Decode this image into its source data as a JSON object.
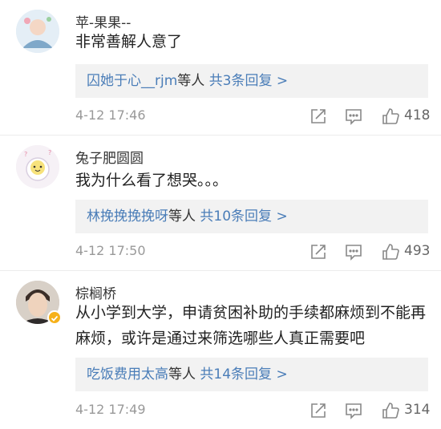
{
  "comments": [
    {
      "username": "苹-果果--",
      "text": "非常善解人意了",
      "reply_names": "囚她于心__rjm",
      "reply_mid": "等人",
      "reply_count": "共3条回复 >",
      "time": "4-12 17:46",
      "likes": "418",
      "verified": false
    },
    {
      "username": "兔子肥圆圆",
      "text": "我为什么看了想哭。。。",
      "reply_names": "林挽挽挽挽呀",
      "reply_mid": "等人",
      "reply_count": "共10条回复 >",
      "time": "4-12 17:50",
      "likes": "493",
      "verified": false
    },
    {
      "username": "棕榈桥",
      "text": "从小学到大学，申请贫困补助的手续都麻烦到不能再麻烦，或许是通过来筛选哪些人真正需要吧",
      "reply_names": "吃饭费用太高",
      "reply_mid": "等人",
      "reply_count": "共14条回复 >",
      "time": "4-12 17:49",
      "likes": "314",
      "verified": true
    }
  ],
  "icons": {
    "share": "share-icon",
    "reply": "comment-icon",
    "like": "thumbs-up-icon"
  },
  "colors": {
    "link_blue": "#4a7db8",
    "verified_badge": "#f6b11a",
    "reply_bg": "#f2f2f2"
  }
}
